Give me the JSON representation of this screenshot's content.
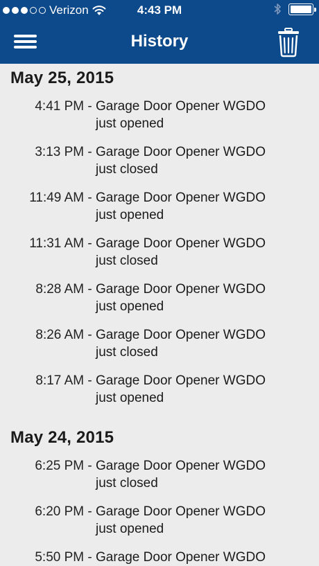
{
  "status_bar": {
    "carrier": "Verizon",
    "time": "4:43 PM",
    "signal_bars": 3,
    "signal_total": 5
  },
  "nav": {
    "title": "History",
    "menu_icon": "hamburger-menu-icon",
    "trash_icon": "trash-icon"
  },
  "sections": [
    {
      "date": "May 25, 2015",
      "entries": [
        {
          "time": "4:41 PM",
          "device": "Garage Door Opener WGDO",
          "event": "just opened"
        },
        {
          "time": "3:13 PM",
          "device": "Garage Door Opener WGDO",
          "event": "just closed"
        },
        {
          "time": "11:49 AM",
          "device": "Garage Door Opener WGDO",
          "event": "just opened"
        },
        {
          "time": "11:31 AM",
          "device": "Garage Door Opener WGDO",
          "event": "just closed"
        },
        {
          "time": "8:28 AM",
          "device": "Garage Door Opener WGDO",
          "event": "just opened"
        },
        {
          "time": "8:26 AM",
          "device": "Garage Door Opener WGDO",
          "event": "just closed"
        },
        {
          "time": "8:17 AM",
          "device": "Garage Door Opener WGDO",
          "event": "just opened"
        }
      ]
    },
    {
      "date": "May 24, 2015",
      "entries": [
        {
          "time": "6:25 PM",
          "device": "Garage Door Opener WGDO",
          "event": "just closed"
        },
        {
          "time": "6:20 PM",
          "device": "Garage Door Opener WGDO",
          "event": "just opened"
        },
        {
          "time": "5:50 PM",
          "device": "Garage Door Opener WGDO",
          "event": ""
        }
      ]
    }
  ],
  "colors": {
    "nav_background": "#0d4a8b",
    "page_background": "#ececec",
    "nav_text": "#ffffff"
  }
}
